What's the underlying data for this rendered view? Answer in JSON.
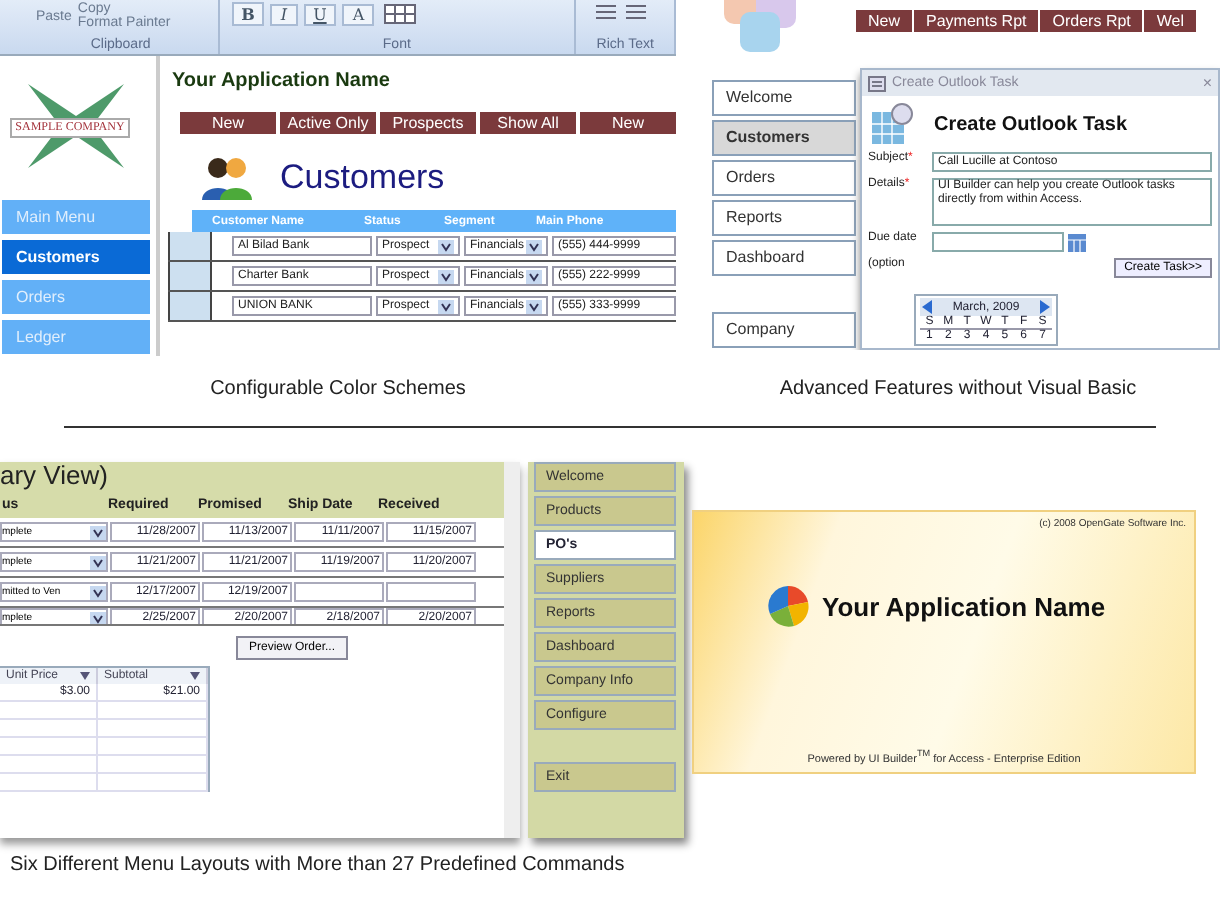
{
  "color_schemes": {
    "ribbon": {
      "clipboard": {
        "label": "Clipboard",
        "paste": "Paste",
        "copy": "Copy",
        "format_painter": "Format Painter"
      },
      "font": {
        "label": "Font",
        "buttons": [
          "B",
          "I",
          "U",
          "A"
        ]
      },
      "rich_text": {
        "label": "Rich Text"
      }
    },
    "logo_text": "SAMPLE COMPANY",
    "menu": [
      {
        "label": "Main Menu",
        "selected": false
      },
      {
        "label": "Customers",
        "selected": true
      },
      {
        "label": "Orders",
        "selected": false
      },
      {
        "label": "Ledger",
        "selected": false
      }
    ],
    "app_title": "Your Application Name",
    "toolbar": [
      "New",
      "Active Only",
      "Prospects",
      "Show All",
      "New"
    ],
    "heading": "Customers",
    "table": {
      "columns": [
        "Customer Name",
        "Status",
        "Segment",
        "Main Phone"
      ],
      "rows": [
        {
          "cells": [
            "Al Bilad Bank",
            "Prospect",
            "Financials",
            "(555) 444-9999"
          ]
        },
        {
          "cells": [
            "Charter Bank",
            "Prospect",
            "Financials",
            "(555) 222-9999"
          ]
        },
        {
          "cells": [
            "UNION BANK",
            "Prospect",
            "Financials",
            "(555) 333-9999"
          ]
        }
      ]
    },
    "caption": "Configurable Color Schemes"
  },
  "advanced_features": {
    "toolbar": [
      "New",
      "Payments Rpt",
      "Orders Rpt",
      "Wel"
    ],
    "menu": [
      {
        "label": "Welcome",
        "selected": false
      },
      {
        "label": "Customers",
        "selected": true
      },
      {
        "label": "Orders",
        "selected": false
      },
      {
        "label": "Reports",
        "selected": false
      },
      {
        "label": "Dashboard",
        "selected": false
      },
      {
        "label": "Company",
        "selected": false
      }
    ],
    "dialog": {
      "window_title": "Create Outlook Task",
      "close": "×",
      "required_mark": "*",
      "heading": "Create Outlook Task",
      "subject_label": "Subject",
      "subject": "Call Lucille at Contoso",
      "details_label": "Details",
      "details": "UI Builder can help you create Outlook tasks directly from within Access.",
      "due_label": "Due date",
      "optional_label": "(option",
      "calendar": {
        "month": "March, 2009",
        "weekdays": [
          "S",
          "M",
          "T",
          "W",
          "T",
          "F",
          "S"
        ],
        "days": [
          "1",
          "2",
          "3",
          "4",
          "5",
          "6",
          "7"
        ]
      },
      "button": "Create Task>>"
    },
    "caption": "Advanced Features without Visual Basic"
  },
  "menu_layouts": {
    "form": {
      "title": "ary View)",
      "columns": [
        "us",
        "Required",
        "Promised",
        "Ship Date",
        "Received"
      ],
      "rows": [
        {
          "status": "mplete",
          "dates": [
            "11/28/2007",
            "11/13/2007",
            "11/11/2007",
            "11/15/2007"
          ]
        },
        {
          "status": "mplete",
          "dates": [
            "11/21/2007",
            "11/21/2007",
            "11/19/2007",
            "11/20/2007"
          ]
        },
        {
          "status": "mitted to Ven",
          "dates": [
            "12/17/2007",
            "12/19/2007"
          ]
        },
        {
          "status": "mplete",
          "dates": [
            "2/25/2007",
            "2/20/2007",
            "2/18/2007",
            "2/20/2007"
          ]
        }
      ],
      "button": "Preview Order...",
      "subgrid": {
        "columns": [
          "Unit Price",
          "Subtotal"
        ],
        "rows": [
          [
            "$3.00",
            "$21.00"
          ]
        ]
      }
    },
    "menu": [
      {
        "label": "Welcome",
        "selected": false
      },
      {
        "label": "Products",
        "selected": false
      },
      {
        "label": "PO's",
        "selected": true
      },
      {
        "label": "Suppliers",
        "selected": false
      },
      {
        "label": "Reports",
        "selected": false
      },
      {
        "label": "Dashboard",
        "selected": false
      },
      {
        "label": "Company Info",
        "selected": false
      },
      {
        "label": "Configure",
        "selected": false
      },
      {
        "label": "Exit",
        "selected": false
      }
    ],
    "caption": "Six Different Menu Layouts with More than 27 Predefined Commands"
  },
  "splash": {
    "copyright": "(c) 2008 OpenGate Software Inc.",
    "title": "Your Application Name",
    "footer": "Powered by UI Builder$^{TM}$ for Access - Enterprise Edition"
  }
}
